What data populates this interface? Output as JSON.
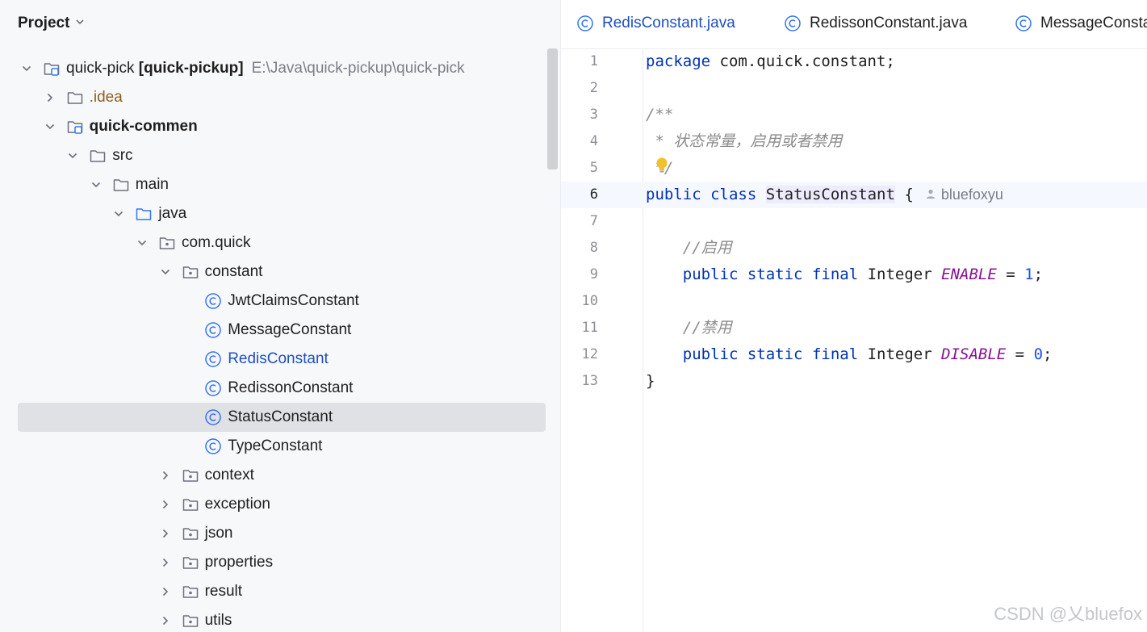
{
  "project_panel": {
    "title": "Project",
    "tree": [
      {
        "label": "quick-pick",
        "suffix": "[quick-pickup]",
        "path": "E:\\Java\\quick-pickup\\quick-pick",
        "icon": "module-folder-icon",
        "chevron": "down",
        "depth": 0
      },
      {
        "label": ".idea",
        "icon": "folder-icon",
        "chevron": "right",
        "depth": 1,
        "style": "brown"
      },
      {
        "label": "quick-commen",
        "icon": "module-folder-icon",
        "chevron": "down",
        "depth": 1,
        "style": "bold"
      },
      {
        "label": "src",
        "icon": "folder-icon",
        "chevron": "down",
        "depth": 2
      },
      {
        "label": "main",
        "icon": "folder-icon",
        "chevron": "down",
        "depth": 3
      },
      {
        "label": "java",
        "icon": "source-folder-icon",
        "chevron": "down",
        "depth": 4
      },
      {
        "label": "com.quick",
        "icon": "package-icon",
        "chevron": "down",
        "depth": 5
      },
      {
        "label": "constant",
        "icon": "package-icon",
        "chevron": "down",
        "depth": 6
      },
      {
        "label": "JwtClaimsConstant",
        "icon": "class-icon",
        "chevron": "none",
        "depth": 7
      },
      {
        "label": "MessageConstant",
        "icon": "class-icon",
        "chevron": "none",
        "depth": 7
      },
      {
        "label": "RedisConstant",
        "icon": "class-icon",
        "chevron": "none",
        "depth": 7,
        "style": "blue"
      },
      {
        "label": "RedissonConstant",
        "icon": "class-icon",
        "chevron": "none",
        "depth": 7
      },
      {
        "label": "StatusConstant",
        "icon": "class-icon",
        "chevron": "none",
        "depth": 7,
        "selected": true
      },
      {
        "label": "TypeConstant",
        "icon": "class-icon",
        "chevron": "none",
        "depth": 7
      },
      {
        "label": "context",
        "icon": "package-icon",
        "chevron": "right",
        "depth": 6
      },
      {
        "label": "exception",
        "icon": "package-icon",
        "chevron": "right",
        "depth": 6
      },
      {
        "label": "json",
        "icon": "package-icon",
        "chevron": "right",
        "depth": 6
      },
      {
        "label": "properties",
        "icon": "package-icon",
        "chevron": "right",
        "depth": 6
      },
      {
        "label": "result",
        "icon": "package-icon",
        "chevron": "right",
        "depth": 6
      },
      {
        "label": "utils",
        "icon": "package-icon",
        "chevron": "right",
        "depth": 6
      }
    ]
  },
  "editor": {
    "tabs": [
      {
        "label": "RedisConstant.java",
        "active": true
      },
      {
        "label": "RedissonConstant.java",
        "active": false
      },
      {
        "label": "MessageConsta",
        "active": false
      }
    ],
    "current_line": 6,
    "lines": [
      {
        "n": "1",
        "tokens": [
          [
            "kw",
            "package"
          ],
          [
            "",
            "com.quick.constant;"
          ]
        ]
      },
      {
        "n": "2",
        "tokens": []
      },
      {
        "n": "3",
        "tokens": [
          [
            "cm",
            "/**"
          ]
        ]
      },
      {
        "n": "4",
        "tokens": [
          [
            "cm",
            " * 状态常量，启用或者禁用"
          ]
        ]
      },
      {
        "n": "5",
        "tokens": [
          [
            "cm",
            " */"
          ]
        ]
      },
      {
        "n": "6",
        "tokens": [
          [
            "kw",
            "public"
          ],
          [
            "kw",
            "class"
          ],
          [
            "hl",
            "StatusConstant"
          ],
          [
            "",
            "{"
          ]
        ],
        "author": "bluefoxyu"
      },
      {
        "n": "7",
        "tokens": []
      },
      {
        "n": "8",
        "tokens": [
          [
            "cm",
            "    //启用"
          ]
        ]
      },
      {
        "n": "9",
        "tokens": [
          [
            "kw",
            "    public"
          ],
          [
            "kw",
            "static"
          ],
          [
            "kw",
            "final"
          ],
          [
            "",
            "Integer"
          ],
          [
            "cf",
            "ENABLE"
          ],
          [
            "",
            "="
          ],
          [
            "num",
            "1"
          ],
          [
            "",
            ";"
          ]
        ]
      },
      {
        "n": "10",
        "tokens": []
      },
      {
        "n": "11",
        "tokens": [
          [
            "cm",
            "    //禁用"
          ]
        ]
      },
      {
        "n": "12",
        "tokens": [
          [
            "kw",
            "    public"
          ],
          [
            "kw",
            "static"
          ],
          [
            "kw",
            "final"
          ],
          [
            "",
            "Integer"
          ],
          [
            "cf",
            "DISABLE"
          ],
          [
            "",
            "="
          ],
          [
            "num",
            "0"
          ],
          [
            "",
            ";"
          ]
        ]
      },
      {
        "n": "13",
        "tokens": [
          [
            "",
            "}"
          ]
        ]
      }
    ]
  },
  "watermark": "CSDN @乂bluefox",
  "colors": {
    "keyword": "#0033b3",
    "comment": "#8c8c8c",
    "constant": "#871094",
    "number": "#1750eb",
    "selection": "#dfe1e5",
    "link_blue": "#1f4fbf"
  }
}
